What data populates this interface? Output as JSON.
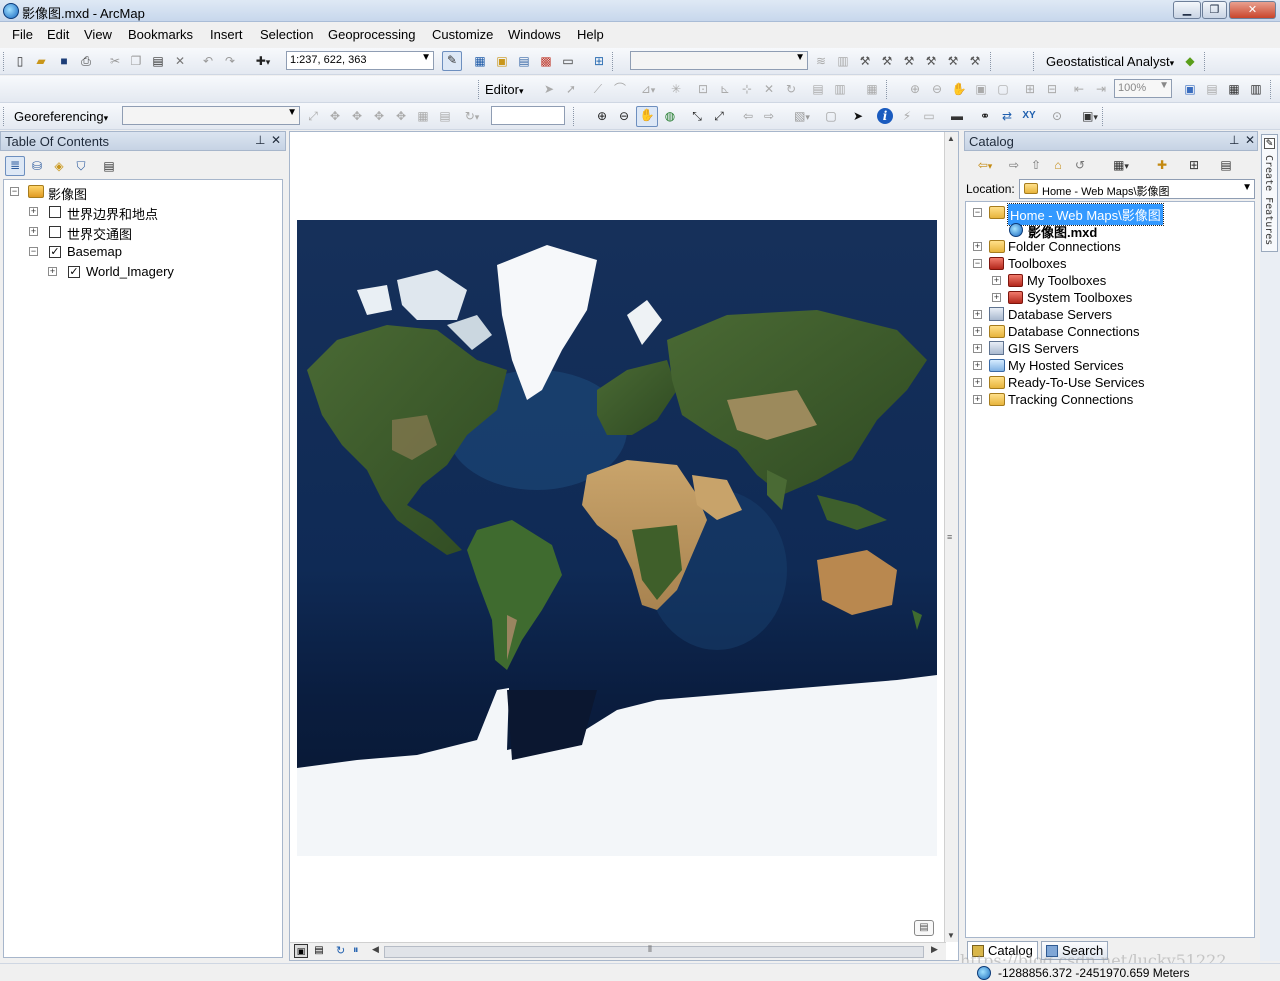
{
  "window": {
    "title": "影像图.mxd - ArcMap",
    "minimize": "▁",
    "maximize": "❐",
    "close": "✕"
  },
  "menu": [
    "File",
    "Edit",
    "View",
    "Bookmarks",
    "Insert",
    "Selection",
    "Geoprocessing",
    "Customize",
    "Windows",
    "Help"
  ],
  "toolbar": {
    "scale": "1:237, 622, 363",
    "geostat": "Geostatistical Analyst",
    "editor": "Editor",
    "zoom_level": "100%",
    "georef": "Georeferencing"
  },
  "toc": {
    "title": "Table Of Contents",
    "pin": "ᵖ",
    "close": "✕",
    "map_name": "影像图",
    "layers": [
      {
        "label": "世界边界和地点",
        "checked": false
      },
      {
        "label": "世界交通图",
        "checked": false
      },
      {
        "label": "Basemap",
        "checked": true
      },
      {
        "label": "World_Imagery",
        "checked": true
      }
    ]
  },
  "catalog": {
    "title": "Catalog",
    "location_label": "Location:",
    "location_value": "Home - Web Maps\\影像图",
    "home_item": "Home - Web Maps\\影像图",
    "mxd_item": "影像图.mxd",
    "items": [
      "Folder Connections",
      "Toolboxes",
      "My Toolboxes",
      "System Toolboxes",
      "Database Servers",
      "Database Connections",
      "GIS Servers",
      "My Hosted Services",
      "Ready-To-Use Services",
      "Tracking Connections"
    ],
    "tab_catalog": "Catalog",
    "tab_search": "Search"
  },
  "side": {
    "create_features": "Create Features"
  },
  "status": {
    "coordinates": "-1288856.372  -2451970.659 Meters",
    "watermark": "https://blog.csdn.net/lucky51222"
  },
  "colors": {
    "accent": "#3399ff",
    "selected_bg": "#3399ff",
    "ocean": "#12315e"
  }
}
